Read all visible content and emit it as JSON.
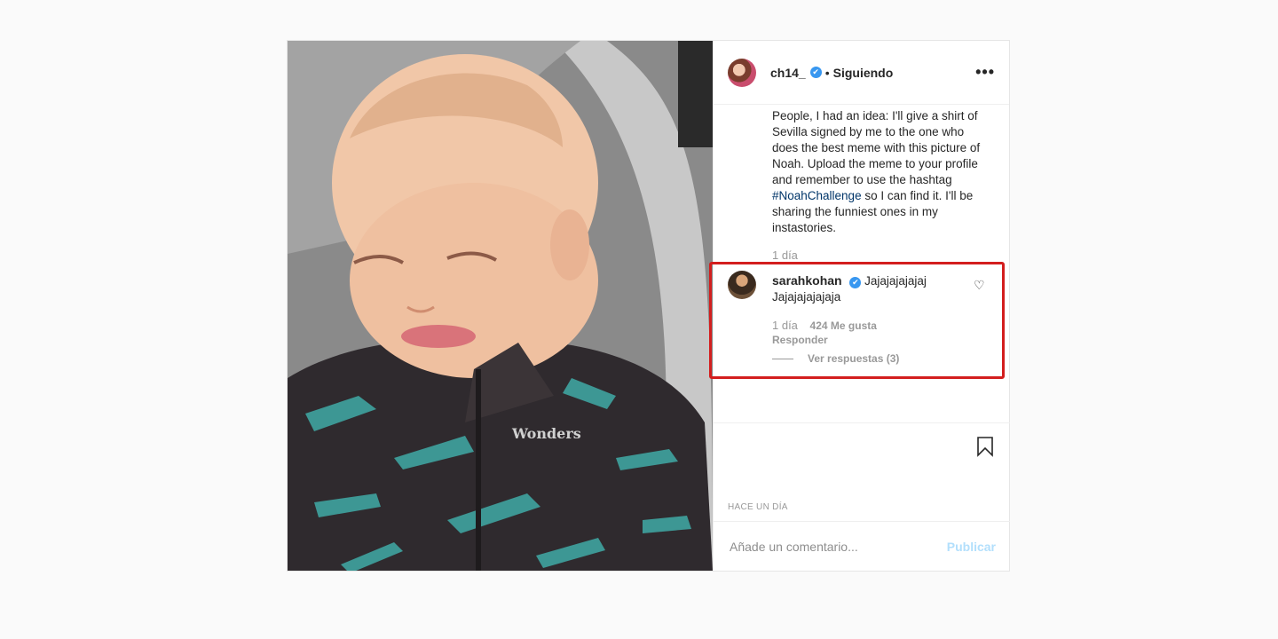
{
  "post": {
    "author": "ch14_",
    "separator": "•",
    "follow_status": "Siguiendo",
    "more_label": "•••",
    "verified_mark": "✔",
    "caption_part1": "People, I had an idea: I'll give a shirt of Sevilla signed by me to the one who does the best meme with this picture of Noah. Upload the meme to your profile and remember to use the hashtag ",
    "hashtag": "#NoahChallenge",
    "caption_part2": " so I can find it. I'll be sharing the funniest ones in my instastories.",
    "caption_time": "1 día",
    "photo_text": "Wonders",
    "date": "HACE UN DÍA"
  },
  "comment": {
    "user": "sarahkohan",
    "text": "Jajajajajajaj Jajajajajajaja",
    "time": "1 día",
    "likes": "424 Me gusta",
    "reply_label": "Responder",
    "view_replies": "Ver respuestas (3)",
    "heart_glyph": "♡"
  },
  "composer": {
    "placeholder": "Añade un comentario...",
    "publish_label": "Publicar"
  },
  "colors": {
    "highlight": "#d31e1e",
    "link": "#003569",
    "publish_disabled": "#b2dffc"
  }
}
